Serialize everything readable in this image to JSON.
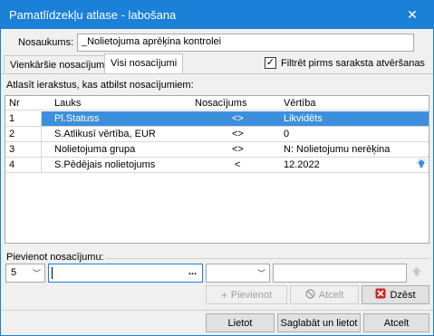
{
  "window": {
    "title": "Pamatlīdzekļu atlase - labošana",
    "close_glyph": "✕"
  },
  "nosaukums": {
    "label": "Nosaukums:",
    "value": "_Nolietojuma aprēķina kontrolei"
  },
  "tabs": [
    {
      "label": "Vienkāršie nosacījumi"
    },
    {
      "label": "Visi nosacījumi"
    }
  ],
  "filter": {
    "label": "Filtrēt pirms saraksta atvēršanas",
    "checked": true,
    "check_glyph": "✓"
  },
  "grid": {
    "caption": "Atlasīt ierakstus, kas atbilst nosacījumiem:",
    "columns": {
      "nr": "Nr",
      "lauks": "Lauks",
      "nosacijums": "Nosacījums",
      "vertiba": "Vērtība"
    },
    "rows": [
      {
        "nr": "1",
        "lauks": "Pl.Statuss",
        "nosacijums": "<>",
        "vertiba": "Likvidēts",
        "selected": true
      },
      {
        "nr": "2",
        "lauks": "S.Atlikusī vērtība, EUR",
        "nosacijums": "<>",
        "vertiba": "0"
      },
      {
        "nr": "3",
        "lauks": "Nolietojuma grupa",
        "nosacijums": "<>",
        "vertiba": "N: Nolietojumu nerēķina"
      },
      {
        "nr": "4",
        "lauks": "S.Pēdējais nolietojums",
        "nosacijums": "<",
        "vertiba": "12.2022"
      }
    ]
  },
  "add": {
    "label": "Pievienot nosacījumu:",
    "nr_value": "5",
    "field_value": "",
    "dots": "...",
    "condition_value": "",
    "value": ""
  },
  "buttons": {
    "pievienot": "Pievienot",
    "atcelt_row": "Atcelt",
    "dzest": "Dzēst",
    "lietot": "Lietot",
    "saglabat": "Saglabāt un lietot",
    "atcelt": "Atcelt"
  },
  "colors": {
    "title_bar": "#1a80d8",
    "selection": "#3d8fdc",
    "delete_icon": "#d02020"
  }
}
